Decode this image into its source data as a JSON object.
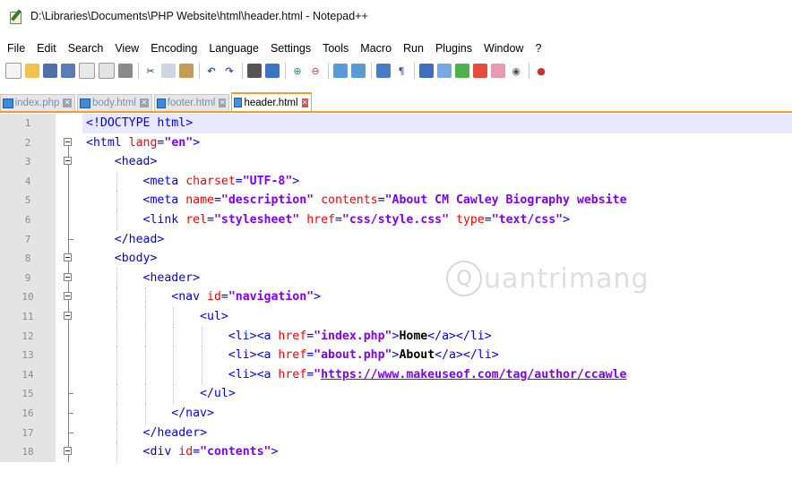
{
  "window": {
    "title": "D:\\Libraries\\Documents\\PHP Website\\html\\header.html - Notepad++"
  },
  "menu": [
    "File",
    "Edit",
    "Search",
    "View",
    "Encoding",
    "Language",
    "Settings",
    "Tools",
    "Macro",
    "Run",
    "Plugins",
    "Window",
    "?"
  ],
  "toolbar_icons": [
    "new-file-icon",
    "open-file-icon",
    "save-icon",
    "save-all-icon",
    "close-icon",
    "close-all-icon",
    "print-icon",
    "cut-icon",
    "copy-icon",
    "paste-icon",
    "undo-icon",
    "redo-icon",
    "find-icon",
    "replace-icon",
    "zoom-in-icon",
    "zoom-out-icon",
    "sync-vertical-icon",
    "sync-horizontal-icon",
    "word-wrap-icon",
    "show-all-chars-icon",
    "indent-guide-icon",
    "udl-icon",
    "doc-map-icon",
    "function-list-icon",
    "folder-workspace-icon",
    "monitor-icon",
    "record-macro-icon"
  ],
  "tabs": [
    {
      "label": "index.php",
      "active": false
    },
    {
      "label": "body.html",
      "active": false
    },
    {
      "label": "footer.html",
      "active": false
    },
    {
      "label": "header.html",
      "active": true
    }
  ],
  "editor": {
    "lines": [
      {
        "num": "1",
        "text": "<!DOCTYPE html>"
      },
      {
        "num": "2",
        "text": "<html lang=\"en\">"
      },
      {
        "num": "3",
        "text": "    <head>"
      },
      {
        "num": "4",
        "text": "        <meta charset=\"UTF-8\">"
      },
      {
        "num": "5",
        "text": "        <meta name=\"description\" contents=\"About CM Cawley Biography website"
      },
      {
        "num": "6",
        "text": "        <link rel=\"stylesheet\" href=\"css/style.css\" type=\"text/css\">"
      },
      {
        "num": "7",
        "text": "    </head>"
      },
      {
        "num": "8",
        "text": "    <body>"
      },
      {
        "num": "9",
        "text": "        <header>"
      },
      {
        "num": "10",
        "text": "            <nav id=\"navigation\">"
      },
      {
        "num": "11",
        "text": "                <ul>"
      },
      {
        "num": "12",
        "text": "                    <li><a href=\"index.php\">Home</a></li>"
      },
      {
        "num": "13",
        "text": "                    <li><a href=\"about.php\">About</a></li>"
      },
      {
        "num": "14",
        "text": "                    <li><a href=\"https://www.makeuseof.com/tag/author/ccawle"
      },
      {
        "num": "15",
        "text": "                </ul>"
      },
      {
        "num": "16",
        "text": "            </nav>"
      },
      {
        "num": "17",
        "text": "        </header>"
      },
      {
        "num": "18",
        "text": "        <div id=\"contents\">"
      }
    ]
  },
  "watermark": {
    "text": "uantrimang"
  }
}
